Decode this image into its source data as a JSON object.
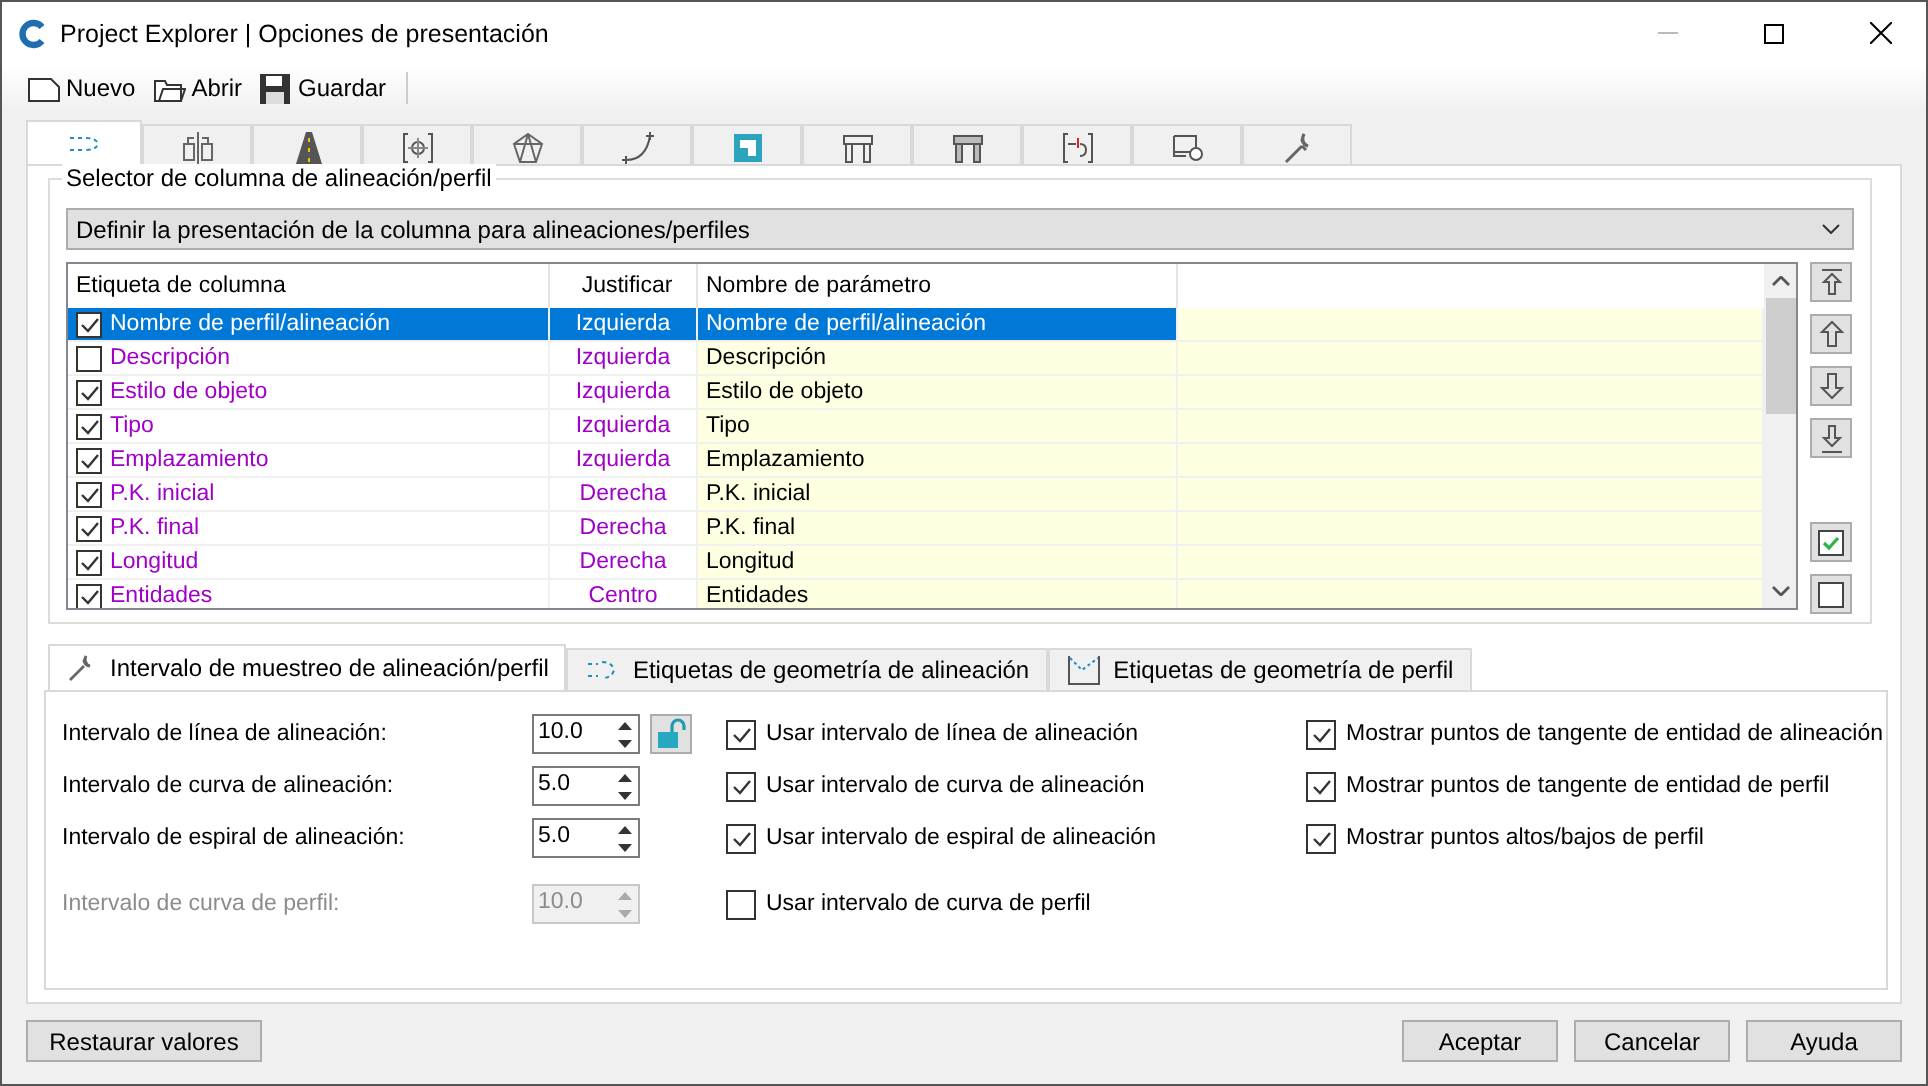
{
  "window": {
    "title": "Project Explorer | Opciones de presentación"
  },
  "toolbar": [
    {
      "label": "Nuevo"
    },
    {
      "label": "Abrir"
    },
    {
      "label": "Guardar"
    }
  ],
  "tabs": [
    {
      "selected": true
    },
    {
      "selected": false
    },
    {
      "selected": false
    },
    {
      "selected": false
    },
    {
      "selected": false
    },
    {
      "selected": false
    },
    {
      "selected": false
    },
    {
      "selected": false
    },
    {
      "selected": false
    },
    {
      "selected": false
    },
    {
      "selected": false
    },
    {
      "selected": false
    }
  ],
  "selector": {
    "title": "Selector de columna de alineación/perfil",
    "dropdown": "Definir la presentación de la columna para alineaciones/perfiles",
    "columns": [
      "Etiqueta de columna",
      "Justificar",
      "Nombre de parámetro"
    ],
    "rows": [
      {
        "checked": true,
        "selected": true,
        "label": "Nombre de perfil/alineación",
        "justify": "Izquierda",
        "parameter": "Nombre de perfil/alineación"
      },
      {
        "checked": false,
        "selected": false,
        "label": "Descripción",
        "justify": "Izquierda",
        "parameter": "Descripción"
      },
      {
        "checked": true,
        "selected": false,
        "label": "Estilo de objeto",
        "justify": "Izquierda",
        "parameter": "Estilo de objeto"
      },
      {
        "checked": true,
        "selected": false,
        "label": "Tipo",
        "justify": "Izquierda",
        "parameter": "Tipo"
      },
      {
        "checked": true,
        "selected": false,
        "label": "Emplazamiento",
        "justify": "Izquierda",
        "parameter": "Emplazamiento"
      },
      {
        "checked": true,
        "selected": false,
        "label": "P.K. inicial",
        "justify": "Derecha",
        "parameter": "P.K. inicial"
      },
      {
        "checked": true,
        "selected": false,
        "label": "P.K. final",
        "justify": "Derecha",
        "parameter": "P.K. final"
      },
      {
        "checked": true,
        "selected": false,
        "label": "Longitud",
        "justify": "Derecha",
        "parameter": "Longitud"
      },
      {
        "checked": true,
        "selected": false,
        "label": "Entidades",
        "justify": "Centro",
        "parameter": "Entidades"
      }
    ]
  },
  "sub_tabs": [
    {
      "label": "Intervalo de muestreo de alineación/perfil",
      "selected": true
    },
    {
      "label": "Etiquetas de geometría de alineación",
      "selected": false
    },
    {
      "label": "Etiquetas de geometría de perfil",
      "selected": false
    }
  ],
  "intervals": [
    {
      "label": "Intervalo de línea de alineación:",
      "value": "10.0",
      "disabled": false,
      "lock": true
    },
    {
      "label": "Intervalo de curva de alineación:",
      "value": "5.0",
      "disabled": false,
      "lock": false
    },
    {
      "label": "Intervalo de espiral de alineación:",
      "value": "5.0",
      "disabled": false,
      "lock": false
    },
    {
      "label": "Intervalo de curva de perfil:",
      "value": "10.0",
      "disabled": true,
      "lock": false
    }
  ],
  "use_options": [
    {
      "label": "Usar intervalo de línea de alineación",
      "checked": true
    },
    {
      "label": "Usar intervalo de curva de alineación",
      "checked": true
    },
    {
      "label": "Usar intervalo de espiral de alineación",
      "checked": true
    },
    {
      "label": "Usar intervalo de curva de perfil",
      "checked": false
    }
  ],
  "show_options": [
    {
      "label": "Mostrar puntos de tangente de entidad de alineación",
      "checked": true
    },
    {
      "label": "Mostrar puntos de tangente de entidad de perfil",
      "checked": true
    },
    {
      "label": "Mostrar puntos altos/bajos de perfil",
      "checked": true
    }
  ],
  "restore_button": "Restaurar valores",
  "buttons": [
    "Aceptar",
    "Cancelar",
    "Ayuda"
  ]
}
